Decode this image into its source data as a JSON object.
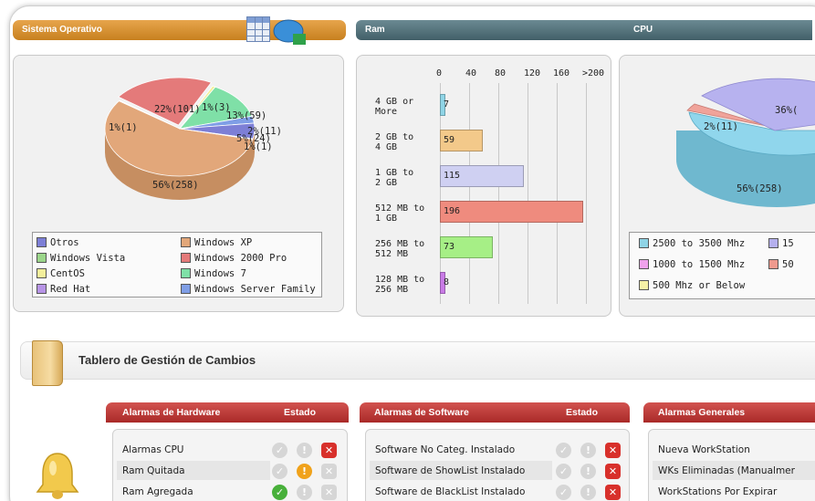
{
  "headers": {
    "os": "Sistema Operativo",
    "ram": "Ram",
    "cpu": "CPU"
  },
  "os_chart": {
    "type": "pie",
    "labels": {
      "xp": "56%(258)",
      "pro2000": "22%(101)",
      "vista": "1%(1)",
      "centos": "1%(3)",
      "win7": "13%(59)",
      "server": "2%(11)",
      "otros": "5%(24)",
      "redhat": "1%(1)"
    },
    "legend": [
      {
        "label": "Otros",
        "color": "#7d7fd6"
      },
      {
        "label": "Windows XP",
        "color": "#e2a77a"
      },
      {
        "label": "Windows Vista",
        "color": "#9bd68a"
      },
      {
        "label": "Windows 2000 Pro",
        "color": "#e47a7a"
      },
      {
        "label": "CentOS",
        "color": "#f3ef9b"
      },
      {
        "label": "Windows 7",
        "color": "#7fe0a7"
      },
      {
        "label": "Red Hat",
        "color": "#b794e6"
      },
      {
        "label": "Windows Server Family",
        "color": "#7f9ee6"
      }
    ]
  },
  "ram_chart": {
    "type": "bar",
    "ticks": [
      "0",
      "40",
      "80",
      "120",
      "160",
      ">200"
    ],
    "categories": [
      "4 GB or\nMore",
      "2 GB to\n4 GB",
      "1 GB to\n2 GB",
      "512 MB to\n1 GB",
      "256 MB to\n512 MB",
      "128 MB to\n256 MB"
    ],
    "values": [
      7,
      59,
      115,
      196,
      73,
      8
    ],
    "colors": [
      "#8fd4e6",
      "#f3c98a",
      "#cfd0f2",
      "#ef8b7e",
      "#a6ef86",
      "#c97be6"
    ]
  },
  "cpu_chart": {
    "type": "pie",
    "labels": {
      "main": "56%(258)",
      "small": "2%(11)",
      "right": "36%("
    },
    "legend": [
      {
        "label": "2500 to 3500 Mhz",
        "color": "#8fd4e6"
      },
      {
        "label": "15",
        "color": "#b5b0ee"
      },
      {
        "label": "1000 to 1500 Mhz",
        "color": "#f0a2ec"
      },
      {
        "label": "50",
        "color": "#ef9a8e"
      },
      {
        "label": "500 Mhz or Below",
        "color": "#f7f2a6"
      }
    ]
  },
  "tablero": {
    "title": "Tablero de Gestión de Cambios"
  },
  "alarms": {
    "hardware": {
      "title": "Alarmas de Hardware",
      "state_label": "Estado",
      "rows": [
        "Alarmas CPU",
        "Ram Quitada",
        "Ram Agregada"
      ]
    },
    "software": {
      "title": "Alarmas de Software",
      "state_label": "Estado",
      "rows": [
        "Software No Categ. Instalado",
        "Software de ShowList Instalado",
        "Software de BlackList Instalado"
      ]
    },
    "general": {
      "title": "Alarmas Generales",
      "rows": [
        "Nueva WorkStation",
        "WKs Eliminadas (Manualmer",
        "WorkStations Por Expirar"
      ]
    },
    "icons": {
      "ok": "✓",
      "warn": "!",
      "x": "✕"
    }
  }
}
